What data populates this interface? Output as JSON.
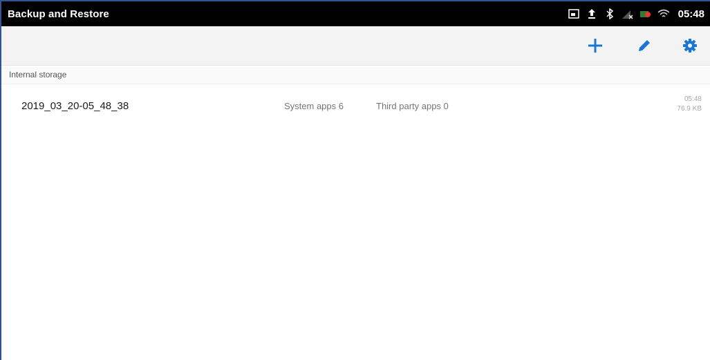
{
  "status_bar": {
    "title": "Backup and Restore",
    "clock": "05:48",
    "icons": [
      "screenshot-icon",
      "upload-icon",
      "bluetooth-icon",
      "signal-off-icon",
      "battery-icon",
      "wifi-icon"
    ]
  },
  "toolbar": {
    "actions": [
      "add-icon",
      "edit-icon",
      "settings-icon"
    ],
    "accent_color": "#1976d2"
  },
  "section": {
    "label": "Internal storage"
  },
  "backups": [
    {
      "name": "2019_03_20-05_48_38",
      "system_apps": "System apps  6",
      "third_party_apps": "Third party apps  0",
      "time": "05:48",
      "size": "76.9 KB"
    }
  ]
}
